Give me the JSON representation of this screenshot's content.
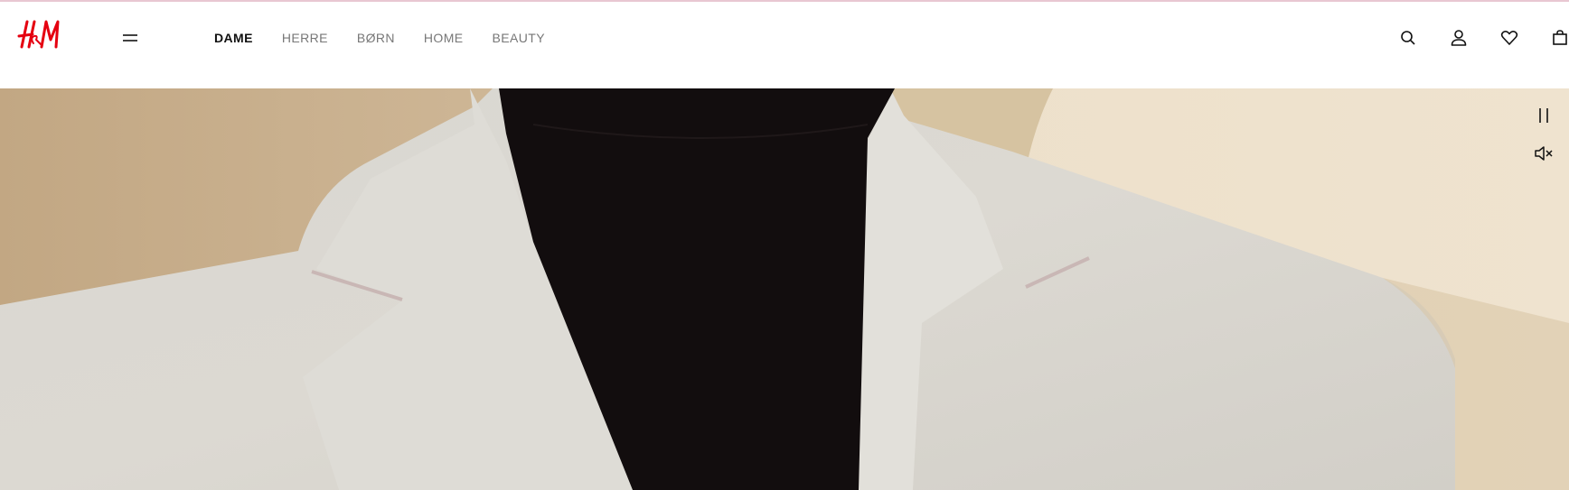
{
  "brand": {
    "logo_text": "H&M",
    "logo_color": "#e50010"
  },
  "nav": {
    "items": [
      {
        "label": "DAME",
        "active": true
      },
      {
        "label": "HERRE",
        "active": false
      },
      {
        "label": "BØRN",
        "active": false
      },
      {
        "label": "HOME",
        "active": false
      },
      {
        "label": "BEAUTY",
        "active": false
      }
    ]
  },
  "header_icons": [
    "search-icon",
    "account-icon",
    "favorites-icon",
    "shopping-bag-icon"
  ],
  "hero": {
    "media": "video",
    "controls": [
      "pause-icon",
      "mute-icon"
    ]
  },
  "colors": {
    "accent": "#e50010",
    "text_active": "#111111",
    "text_inactive": "#777777"
  }
}
